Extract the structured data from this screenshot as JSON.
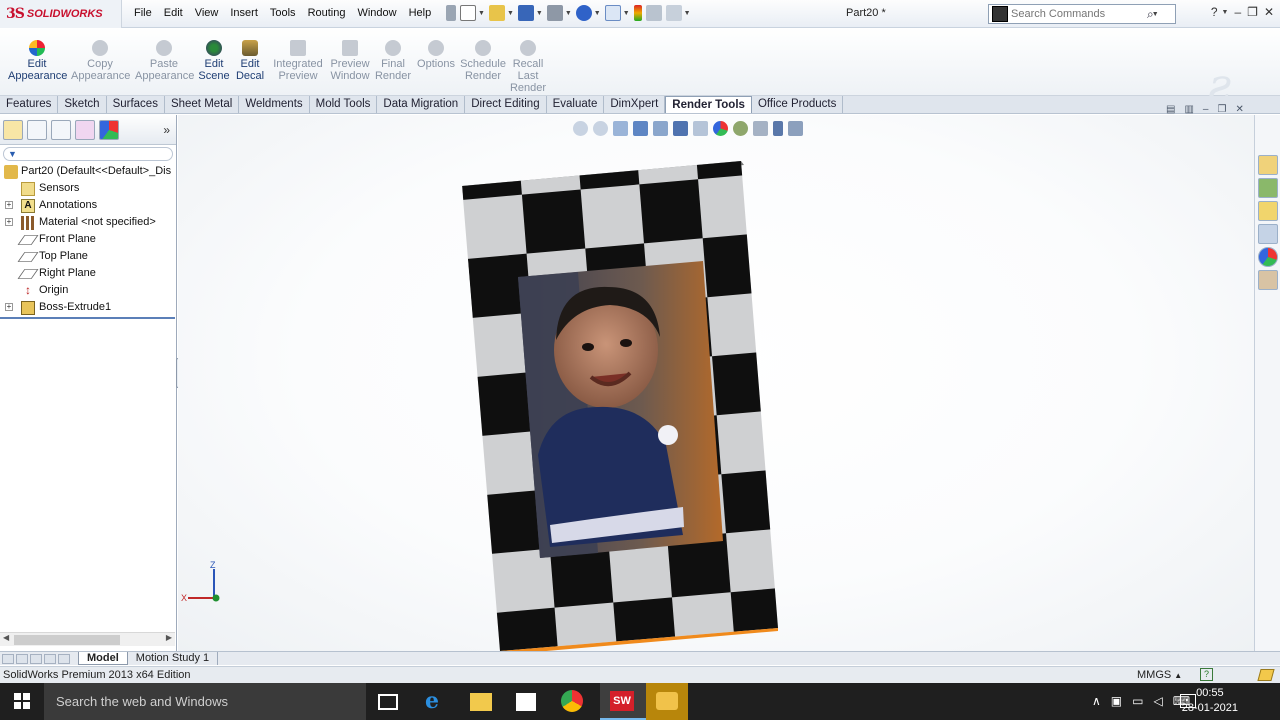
{
  "app": {
    "brand": "SOLIDWORKS",
    "brand_mark": "3S",
    "document_title": "Part20 *"
  },
  "menus": [
    "File",
    "Edit",
    "View",
    "Insert",
    "Tools",
    "Routing",
    "Window",
    "Help"
  ],
  "search": {
    "placeholder": "Search Commands"
  },
  "command_manager": [
    {
      "label1": "Edit",
      "label2": "Appearance",
      "label3": "",
      "enabled": true,
      "icon": "appearance-icon"
    },
    {
      "label1": "Copy",
      "label2": "Appearance",
      "label3": "",
      "enabled": false,
      "icon": "copy-appearance-icon"
    },
    {
      "label1": "Paste",
      "label2": "Appearance",
      "label3": "",
      "enabled": false,
      "icon": "paste-appearance-icon"
    },
    {
      "label1": "Edit",
      "label2": "Scene",
      "label3": "",
      "enabled": true,
      "icon": "scene-icon"
    },
    {
      "label1": "Edit",
      "label2": "Decal",
      "label3": "",
      "enabled": true,
      "icon": "decal-icon"
    },
    {
      "label1": "Integrated",
      "label2": "Preview",
      "label3": "",
      "enabled": false,
      "icon": "integrated-preview-icon"
    },
    {
      "label1": "Preview",
      "label2": "Window",
      "label3": "",
      "enabled": false,
      "icon": "preview-window-icon"
    },
    {
      "label1": "Final",
      "label2": "Render",
      "label3": "",
      "enabled": false,
      "icon": "final-render-icon"
    },
    {
      "label1": "Options",
      "label2": "",
      "label3": "",
      "enabled": false,
      "icon": "options-icon"
    },
    {
      "label1": "Schedule",
      "label2": "Render",
      "label3": "",
      "enabled": false,
      "icon": "schedule-render-icon"
    },
    {
      "label1": "Recall",
      "label2": "Last",
      "label3": "Render",
      "enabled": false,
      "icon": "recall-render-icon"
    }
  ],
  "tabs": [
    "Features",
    "Sketch",
    "Surfaces",
    "Sheet Metal",
    "Weldments",
    "Mold Tools",
    "Data Migration",
    "Direct Editing",
    "Evaluate",
    "DimXpert",
    "Render Tools",
    "Office Products"
  ],
  "active_tab": "Render Tools",
  "tree": {
    "root": "Part20  (Default<<Default>_Dis",
    "items": [
      {
        "label": "Sensors",
        "expandable": false,
        "icon": "sensors-icon"
      },
      {
        "label": "Annotations",
        "expandable": true,
        "icon": "annotations-icon"
      },
      {
        "label": "Material <not specified>",
        "expandable": true,
        "icon": "material-icon"
      },
      {
        "label": "Front Plane",
        "expandable": false,
        "icon": "plane-icon"
      },
      {
        "label": "Top Plane",
        "expandable": false,
        "icon": "plane-icon"
      },
      {
        "label": "Right Plane",
        "expandable": false,
        "icon": "plane-icon"
      },
      {
        "label": "Origin",
        "expandable": false,
        "icon": "origin-icon"
      },
      {
        "label": "Boss-Extrude1",
        "expandable": true,
        "icon": "extrude-icon"
      }
    ]
  },
  "triad": {
    "z_label": "Z",
    "x_label": "X"
  },
  "bottom_tabs": [
    "Model",
    "Motion Study 1"
  ],
  "status": {
    "left": "SolidWorks Premium 2013 x64 Edition",
    "units": "MMGS",
    "help": "?"
  },
  "taskbar": {
    "search_placeholder": "Search the web and Windows",
    "time": "00:55",
    "date": "28-01-2021"
  },
  "colors": {
    "accent": "#1f3e74",
    "checker_dark": "#0f0f0f",
    "checker_light": "#cfd0d2",
    "edge_orange": "#f08a1c"
  }
}
